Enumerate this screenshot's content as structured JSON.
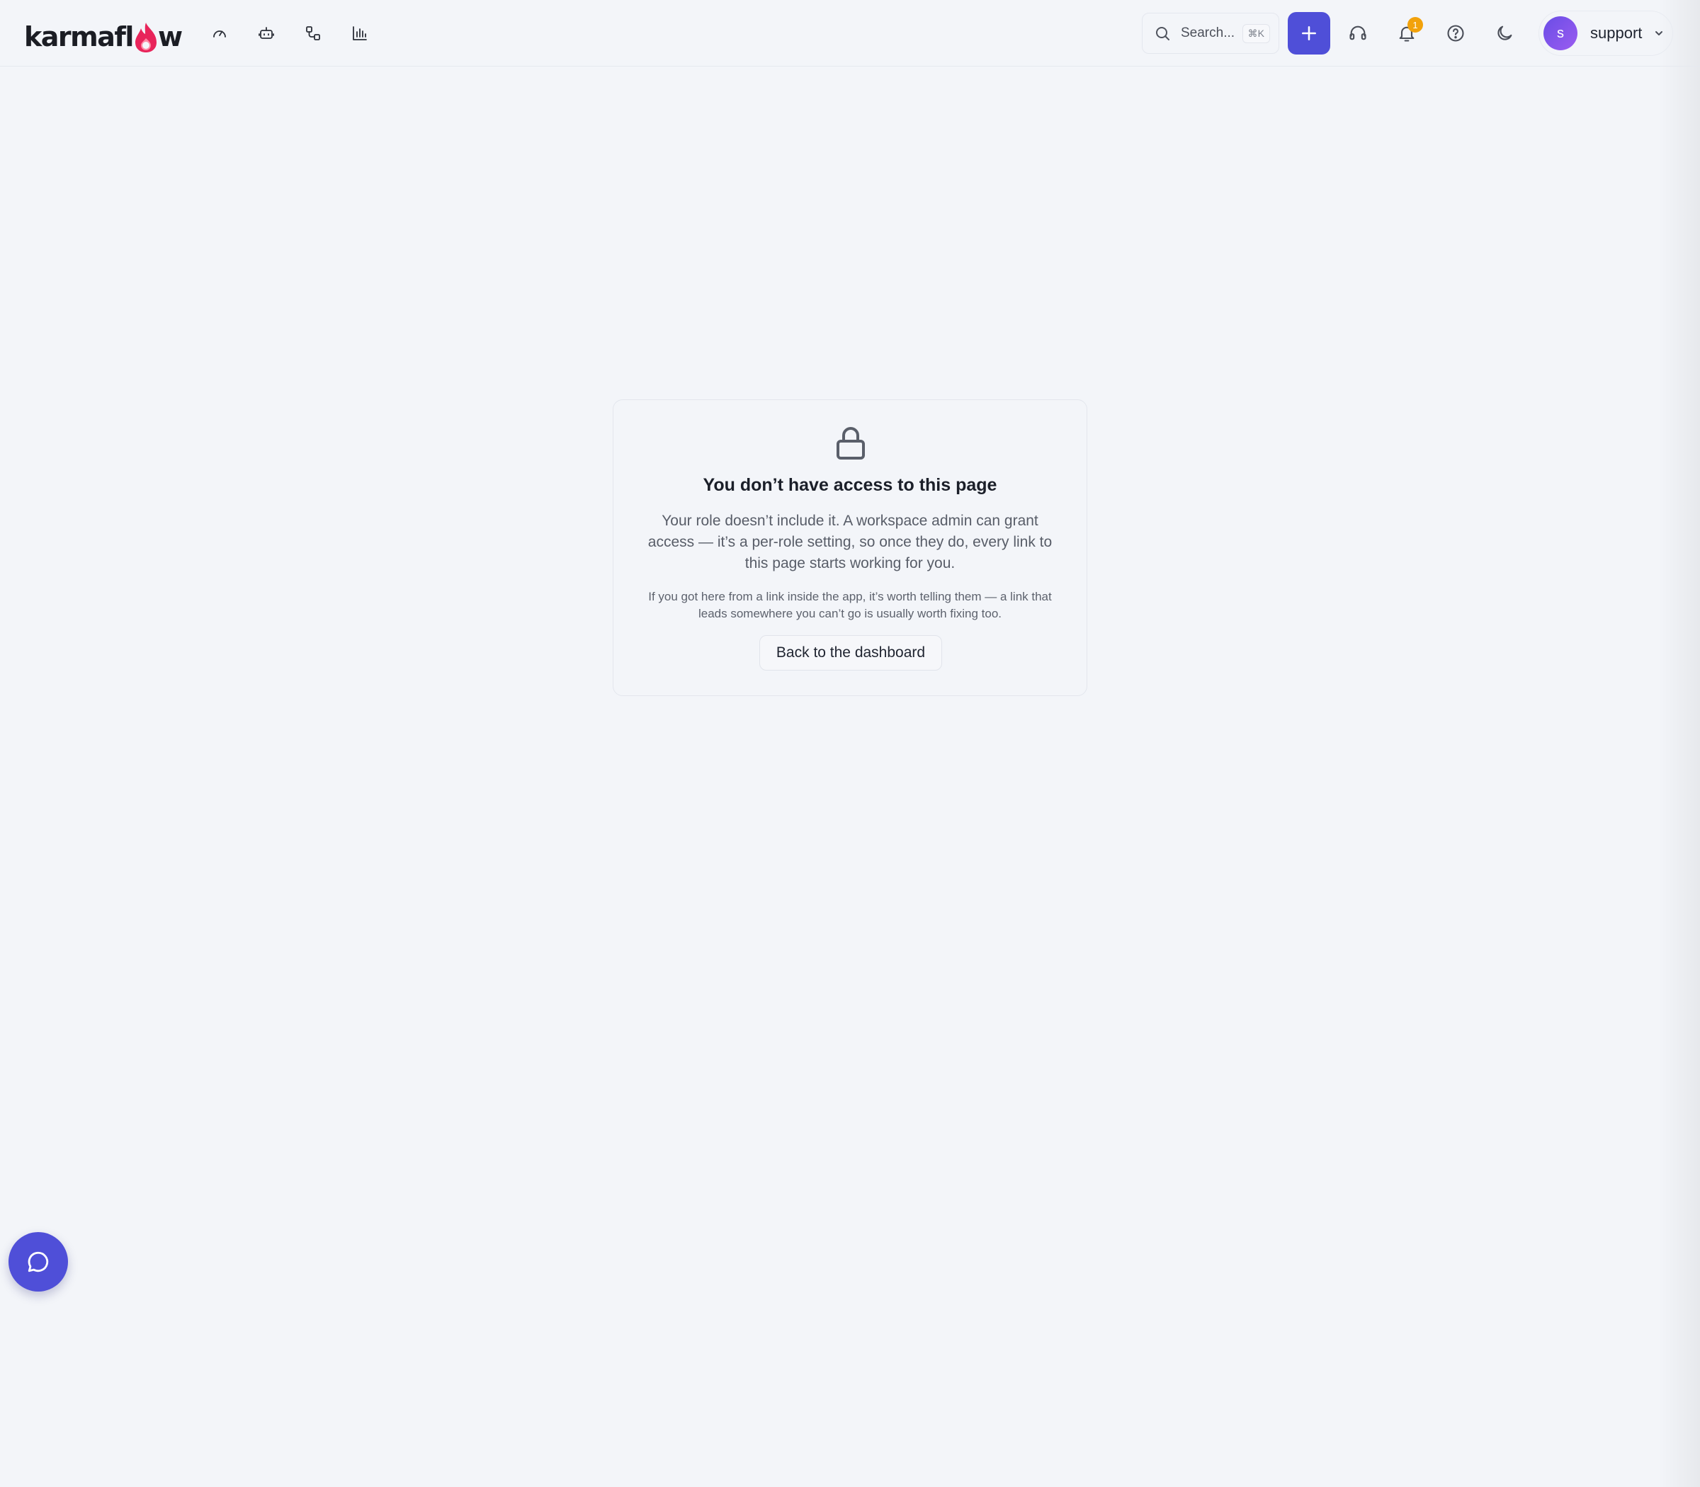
{
  "header": {
    "logo_text_left": "karmafl",
    "logo_text_right": "w",
    "nav_icons": [
      "dashboard-gauge-icon",
      "bot-icon",
      "workflow-icon",
      "bar-chart-icon"
    ],
    "search_placeholder": "Search...",
    "search_shortcut": "⌘K",
    "notification_count": "1",
    "user_initial": "s",
    "user_name": "support",
    "accent_color": "#4f4fd8",
    "badge_color": "#f2a20b"
  },
  "access_denied": {
    "title": "You don’t have access to this page",
    "body": "Your role doesn’t include it. A workspace admin can grant access — it’s a per-role setting, so once they do, every link to this page starts working for you.",
    "note": "If you got here from a link inside the app, it’s worth telling them — a link that leads somewhere you can’t go is usually worth fixing too.",
    "back_button_label": "Back to the dashboard",
    "icon": "lock-icon"
  },
  "chat": {
    "icon": "chat-bubble-icon"
  }
}
